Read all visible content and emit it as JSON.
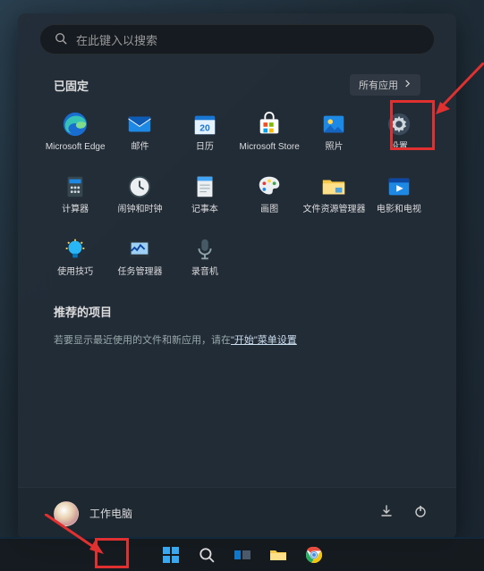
{
  "search": {
    "placeholder": "在此键入以搜索"
  },
  "pinned": {
    "title": "已固定",
    "all_apps_label": "所有应用",
    "apps": [
      {
        "label": "Microsoft Edge",
        "name": "edge-icon"
      },
      {
        "label": "邮件",
        "name": "mail-icon"
      },
      {
        "label": "日历",
        "name": "calendar-icon"
      },
      {
        "label": "Microsoft Store",
        "name": "store-icon"
      },
      {
        "label": "照片",
        "name": "photos-icon"
      },
      {
        "label": "设置",
        "name": "settings-icon"
      },
      {
        "label": "计算器",
        "name": "calculator-icon"
      },
      {
        "label": "闹钟和时钟",
        "name": "clock-icon"
      },
      {
        "label": "记事本",
        "name": "notepad-icon"
      },
      {
        "label": "画图",
        "name": "paint-icon"
      },
      {
        "label": "文件资源管理器",
        "name": "explorer-icon"
      },
      {
        "label": "电影和电视",
        "name": "movies-icon"
      },
      {
        "label": "使用技巧",
        "name": "tips-icon"
      },
      {
        "label": "任务管理器",
        "name": "taskmgr-icon"
      },
      {
        "label": "录音机",
        "name": "recorder-icon"
      }
    ]
  },
  "recommended": {
    "title": "推荐的项目",
    "hint_prefix": "若要显示最近使用的文件和新应用，请在",
    "hint_link": "\"开始\"菜单设置",
    "hint_suffix": ""
  },
  "footer": {
    "username": "工作电脑"
  },
  "colors": {
    "highlight": "#e03030"
  }
}
